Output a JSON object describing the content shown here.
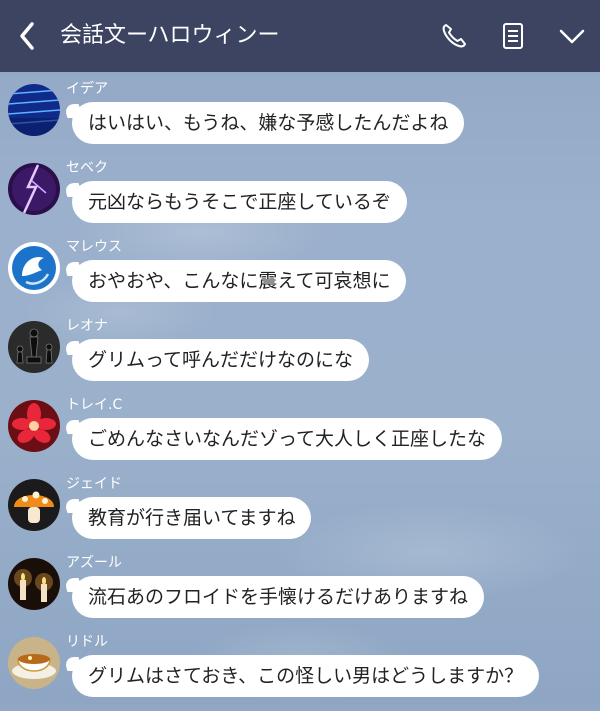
{
  "header": {
    "title": "会話文ーハロウィンー",
    "back_icon": "chevron-left-icon",
    "call_icon": "phone-icon",
    "notes_icon": "notes-icon",
    "menu_icon": "chevron-down-icon"
  },
  "messages": [
    {
      "sender": "イデア",
      "text": "はいはい、もうね、嫌な予感したんだよね",
      "avatar": "blue-digital-avatar"
    },
    {
      "sender": "セベク",
      "text": "元凶ならもうそこで正座しているぞ",
      "avatar": "purple-lightning-avatar"
    },
    {
      "sender": "マレウス",
      "text": "おやおや、こんなに震えて可哀想に",
      "avatar": "blue-dragon-avatar"
    },
    {
      "sender": "レオナ",
      "text": "グリムって呼んだだけなのにな",
      "avatar": "chess-pieces-avatar"
    },
    {
      "sender": "トレイ.C",
      "text": "ごめんなさいなんだゾって大人しく正座したな",
      "avatar": "red-flower-avatar"
    },
    {
      "sender": "ジェイド",
      "text": "教育が行き届いてますね",
      "avatar": "mushroom-avatar"
    },
    {
      "sender": "アズール",
      "text": "流石あのフロイドを手懐けるだけありますね",
      "avatar": "candles-avatar"
    },
    {
      "sender": "リドル",
      "text": "グリムはさておき、この怪しい男はどうしますか？",
      "avatar": "teacup-avatar"
    }
  ]
}
